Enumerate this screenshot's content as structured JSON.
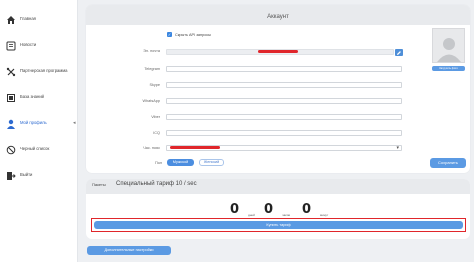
{
  "sidebar": {
    "items": [
      {
        "label": "Главная",
        "icon": "home-icon"
      },
      {
        "label": "Новости",
        "icon": "news-icon"
      },
      {
        "label": "Партнерская программа",
        "icon": "partner-icon"
      },
      {
        "label": "База знаний",
        "icon": "book-icon"
      },
      {
        "label": "Мой профиль",
        "icon": "user-icon"
      },
      {
        "label": "Черный список",
        "icon": "blacklist-icon"
      },
      {
        "label": "Выйти",
        "icon": "logout-icon"
      }
    ],
    "active_index": 4
  },
  "account": {
    "title": "Аккаунт",
    "hide_api_label": "Скрыть API запросы",
    "hide_api_checked": true,
    "fields": [
      {
        "label": "Эл. почта",
        "value": "",
        "filled": true
      },
      {
        "label": "Telegram",
        "value": ""
      },
      {
        "label": "Skype",
        "value": ""
      },
      {
        "label": "WhatsApp",
        "value": ""
      },
      {
        "label": "Viber",
        "value": ""
      },
      {
        "label": "ICQ",
        "value": ""
      },
      {
        "label": "Час. пояс",
        "value": ""
      }
    ],
    "gender_label": "Пол",
    "gender_options": [
      "Мужской",
      "Женский"
    ],
    "gender_selected": "Мужской",
    "save_label": "Сохранить",
    "avatar_button": "Загрузить фото"
  },
  "tariff": {
    "tab_label": "Пакеты",
    "name": "Специальный тариф 10 / sec",
    "countdown": [
      {
        "value": "0",
        "unit": "дней"
      },
      {
        "value": "0",
        "unit": "часов"
      },
      {
        "value": "0",
        "unit": "минут"
      }
    ],
    "buy_label": "Купить тариф"
  },
  "extra_settings_label": "Дополнительные настройки",
  "colors": {
    "accent": "#5b9ae3",
    "highlight": "#e0262b"
  }
}
